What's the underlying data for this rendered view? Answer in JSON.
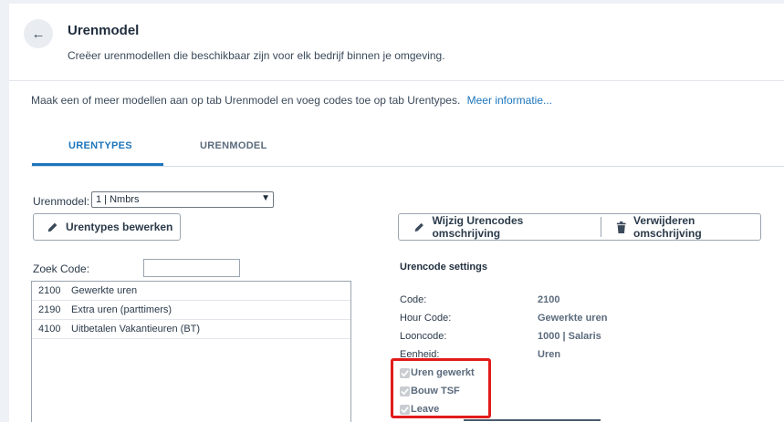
{
  "header": {
    "title": "Urenmodel",
    "subtitle": "Creëer urenmodellen die beschikbaar zijn voor elk bedrijf binnen je omgeving."
  },
  "info": {
    "text": "Maak een of meer modellen aan op tab Urenmodel en voeg codes toe op tab Urentypes.",
    "link": "Meer informatie..."
  },
  "tabs": [
    {
      "label": "URENTYPES",
      "active": true
    },
    {
      "label": "URENMODEL",
      "active": false
    }
  ],
  "form": {
    "urenmodel_label": "Urenmodel:",
    "urenmodel_value": "1 | Nmbrs",
    "edit_types_button": "Urentypes bewerken",
    "zoek_code_label": "Zoek Code:",
    "zoek_code_value": ""
  },
  "actions": {
    "wijzig_button": "Wijzig Urencodes omschrijving",
    "verwijder_button": "Verwijderen omschrijving"
  },
  "codes": [
    {
      "code": "2100",
      "desc": "Gewerkte uren"
    },
    {
      "code": "2190",
      "desc": "Extra uren (parttimers)"
    },
    {
      "code": "4100",
      "desc": "Uitbetalen Vakantieuren (BT)"
    }
  ],
  "settings": {
    "title": "Urencode settings",
    "fields": [
      {
        "label": "Code:",
        "value": "2100"
      },
      {
        "label": "Hour Code:",
        "value": "Gewerkte uren"
      },
      {
        "label": "Looncode:",
        "value": "1000 | Salaris"
      },
      {
        "label": "Eenheid:",
        "value": "Uren"
      }
    ],
    "checks": [
      {
        "label": "Uren gewerkt",
        "checked": true
      },
      {
        "label": "Bouw TSF",
        "checked": true
      },
      {
        "label": "Leave",
        "checked": true
      }
    ]
  },
  "colors": {
    "accent": "#1c75bc",
    "highlight": "#e21b1b"
  }
}
